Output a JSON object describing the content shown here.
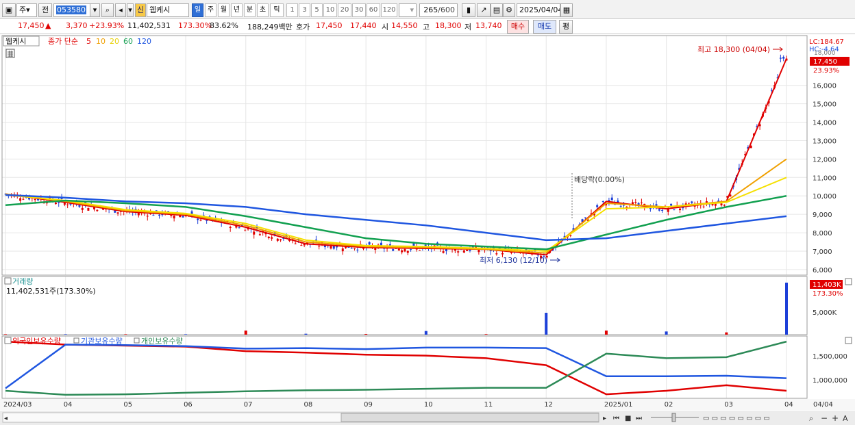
{
  "toolbar": {
    "type_selector": "주",
    "prev_label": "전",
    "stock_code": "053580",
    "credit_badge": "신",
    "stock_name": "웹케시",
    "tf_day": "일",
    "tf_week": "주",
    "tf_month": "월",
    "tf_year": "년",
    "tf_minute": "분",
    "tf_second": "초",
    "tf_tick": "틱",
    "min_1": "1",
    "min_3": "3",
    "min_5": "5",
    "min_10": "10",
    "min_20": "20",
    "min_30": "30",
    "min_60": "60",
    "min_120": "120",
    "count_display": "265",
    "count_max": "/600",
    "date": "2025/04/04"
  },
  "quote": {
    "price": "17,450",
    "arrow": "▲",
    "change": "3,370",
    "change_pct": "+23.93%",
    "volume": "11,402,531",
    "vol_ratio": "173.30%",
    "turnover": "83.62%",
    "amount": "188,249백만",
    "hoga_label": "호가",
    "ask": "17,450",
    "bid": "17,440",
    "open_label": "시",
    "open": "14,550",
    "high_label": "고",
    "high": "18,300",
    "low_label": "저",
    "low": "13,740",
    "buy_label": "매수",
    "sell_label": "매도",
    "extra_label": "평"
  },
  "price_panel": {
    "stock_tag": "웹케시",
    "legend_prefix": "종가 단순",
    "ma5": "5",
    "ma10": "10",
    "ma20": "20",
    "ma60": "60",
    "ma120": "120",
    "lc_label": "LC:184.67",
    "hc_label": "HC:-4.64",
    "top_tick": "18,000",
    "last_price": "17,450",
    "last_pct": "23.93%",
    "high_note": "최고 18,300 (04/04)",
    "low_note": "최저 6,130 (12/10)",
    "div_note": "배당락(0.00%)",
    "y_ticks": [
      "16,000",
      "15,000",
      "14,000",
      "13,000",
      "12,000",
      "11,000",
      "10,000",
      "9,000",
      "8,000",
      "7,000",
      "6,000"
    ]
  },
  "volume_panel": {
    "title": "거래량",
    "info": "11,402,531주(173.30%)",
    "last": "11,403K",
    "last_pct": "173.30%",
    "tick": "5,000K"
  },
  "holding_panel": {
    "legend_foreign": "외국인보유수량",
    "legend_inst": "기관보유수량",
    "legend_indiv": "개인보유수량",
    "ticks": [
      "1,500,000",
      "1,000,000"
    ]
  },
  "x_axis": {
    "labels": [
      "2024/03",
      "04",
      "05",
      "06",
      "07",
      "08",
      "09",
      "10",
      "11",
      "12",
      "2025/01",
      "02",
      "03",
      "04"
    ],
    "last_date": "04/04"
  },
  "colors": {
    "up": "#e00000",
    "down": "#1c3fd8",
    "ma5": "#e00000",
    "ma10": "#f0a000",
    "ma20": "#f5e000",
    "ma60": "#12a050",
    "ma120": "#1f56e0",
    "foreign": "#e00000",
    "inst": "#1f56e0",
    "indiv": "#2d8a57"
  },
  "chart_data": [
    {
      "type": "line",
      "title": "웹케시 종가 단순",
      "x": [
        "2024/03",
        "04",
        "05",
        "06",
        "07",
        "08",
        "09",
        "10",
        "11",
        "12",
        "2025/01",
        "02",
        "03",
        "04"
      ],
      "series": [
        {
          "name": "5",
          "values": [
            10100,
            9650,
            9150,
            8950,
            8300,
            7400,
            7200,
            7150,
            7100,
            6800,
            9700,
            9300,
            9700,
            17450
          ]
        },
        {
          "name": "10",
          "values": [
            10100,
            9700,
            9200,
            9000,
            8400,
            7500,
            7250,
            7200,
            7100,
            6900,
            9600,
            9400,
            9700,
            12000
          ]
        },
        {
          "name": "20",
          "values": [
            10050,
            9750,
            9250,
            9050,
            8500,
            7600,
            7300,
            7250,
            7150,
            7000,
            9300,
            9400,
            9650,
            11000
          ]
        },
        {
          "name": "60",
          "values": [
            9500,
            9750,
            9600,
            9400,
            8900,
            8300,
            7700,
            7400,
            7250,
            7100,
            7900,
            8700,
            9400,
            10000
          ]
        },
        {
          "name": "120",
          "values": [
            10050,
            9900,
            9700,
            9600,
            9400,
            9000,
            8700,
            8400,
            8000,
            7600,
            7700,
            8100,
            8500,
            8900
          ]
        }
      ],
      "ylim": [
        5700,
        18700
      ]
    },
    {
      "type": "bar",
      "title": "거래량",
      "x": [
        "2024/03",
        "04",
        "05",
        "06",
        "07",
        "08",
        "09",
        "10",
        "11",
        "12",
        "2025/01",
        "02",
        "03",
        "04"
      ],
      "series": [
        {
          "name": "거래량",
          "values": [
            100000,
            100000,
            100000,
            100000,
            900000,
            200000,
            150000,
            800000,
            120000,
            4800000,
            900000,
            700000,
            500000,
            11402531
          ]
        }
      ],
      "ylim": [
        0,
        12000000
      ]
    },
    {
      "type": "line",
      "title": "보유수량",
      "x": [
        "2024/03",
        "04",
        "05",
        "06",
        "07",
        "08",
        "09",
        "10",
        "11",
        "12",
        "2025/01",
        "02",
        "03",
        "04"
      ],
      "series": [
        {
          "name": "외국인보유수량",
          "values": [
            1780000,
            1720000,
            1700000,
            1680000,
            1590000,
            1560000,
            1520000,
            1500000,
            1450000,
            1310000,
            730000,
            800000,
            910000,
            800000
          ]
        },
        {
          "name": "기관보유수량",
          "values": [
            850000,
            1720000,
            1710000,
            1690000,
            1640000,
            1650000,
            1630000,
            1660000,
            1660000,
            1650000,
            1090000,
            1090000,
            1100000,
            1050000
          ]
        },
        {
          "name": "개인보유수량",
          "values": [
            800000,
            720000,
            730000,
            760000,
            790000,
            810000,
            820000,
            840000,
            860000,
            860000,
            1540000,
            1450000,
            1470000,
            1780000
          ]
        }
      ],
      "ylim": [
        650000,
        1850000
      ]
    }
  ]
}
